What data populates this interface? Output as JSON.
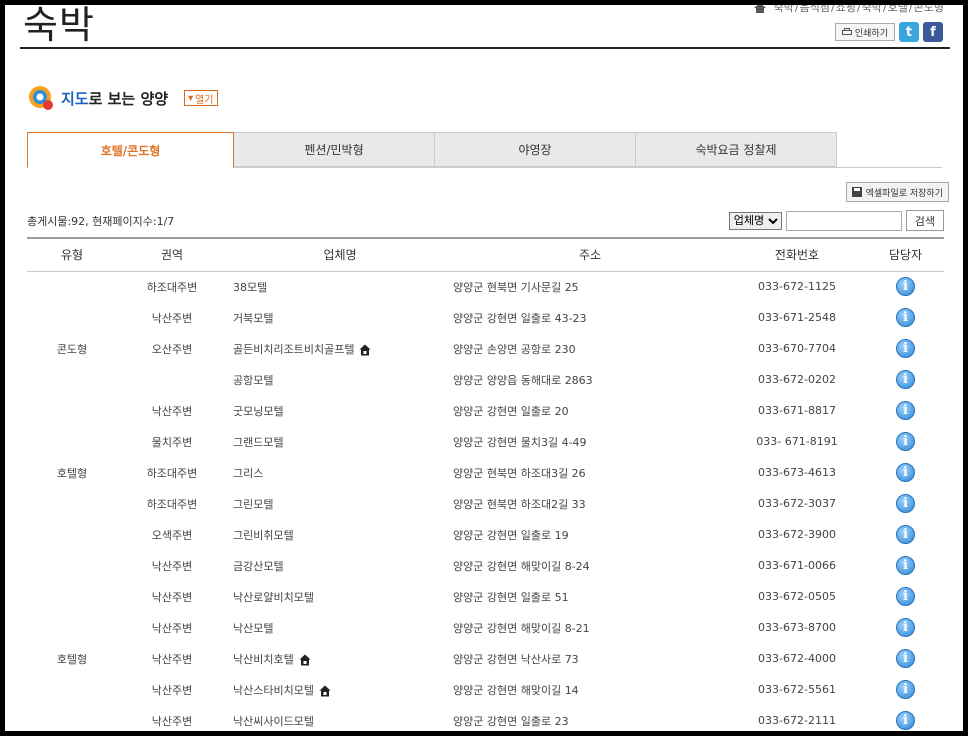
{
  "header": {
    "title": "숙박",
    "breadcrumb": [
      "숙박",
      "음식점",
      "쇼핑",
      "숙박",
      "호텔",
      "콘도형"
    ],
    "print_label": "인쇄하기"
  },
  "map": {
    "title_highlight": "지도",
    "title_rest": "로 보는 양양",
    "open_label": "열기"
  },
  "tabs": [
    {
      "label": "호텔/콘도형",
      "active": true
    },
    {
      "label": "펜션/민박형",
      "active": false
    },
    {
      "label": "야영장",
      "active": false
    },
    {
      "label": "숙박요금 정찰제",
      "active": false
    }
  ],
  "excel_label": "엑셀파일로 저장하기",
  "summary": "총게시물:92, 현재페이지수:1/7",
  "search": {
    "select_value": "업체명",
    "input_value": "",
    "button_label": "검색"
  },
  "table": {
    "headers": [
      "유형",
      "권역",
      "업체명",
      "주소",
      "전화번호",
      "담당자"
    ],
    "rows": [
      {
        "type": "",
        "area": "하조대주변",
        "name": "38모텔",
        "addr": "양양군 현북면 기사문길 25",
        "phone": "033-672-1125",
        "house": false
      },
      {
        "type": "",
        "area": "낙산주변",
        "name": "거북모텔",
        "addr": "양양군 강현면 일출로 43-23",
        "phone": "033-671-2548",
        "house": false
      },
      {
        "type": "콘도형",
        "area": "오산주변",
        "name": "골든비치리조트비치골프텔",
        "addr": "양양군 손양면 공항로 230",
        "phone": "033-670-7704",
        "house": true
      },
      {
        "type": "",
        "area": "",
        "name": "공항모텔",
        "addr": "양양군 양양읍 동해대로 2863",
        "phone": "033-672-0202",
        "house": false
      },
      {
        "type": "",
        "area": "낙산주변",
        "name": "굿모닝모텔",
        "addr": "양양군 강현면 일출로 20",
        "phone": "033-671-8817",
        "house": false
      },
      {
        "type": "",
        "area": "물치주변",
        "name": "그랜드모텔",
        "addr": "양양군 강현면 물치3길 4-49",
        "phone": "033- 671-8191",
        "house": false
      },
      {
        "type": "호텔형",
        "area": "하조대주변",
        "name": "그리스",
        "addr": "양양군 현북면 하조대3길 26",
        "phone": "033-673-4613",
        "house": false
      },
      {
        "type": "",
        "area": "하조대주변",
        "name": "그린모텔",
        "addr": "양양군 현북면 하조대2길 33",
        "phone": "033-672-3037",
        "house": false
      },
      {
        "type": "",
        "area": "오색주변",
        "name": "그린비취모텔",
        "addr": "양양군 강현면 일출로 19",
        "phone": "033-672-3900",
        "house": false
      },
      {
        "type": "",
        "area": "낙산주변",
        "name": "금강산모텔",
        "addr": "양양군 강현면 해맞이길 8-24",
        "phone": "033-671-0066",
        "house": false
      },
      {
        "type": "",
        "area": "낙산주변",
        "name": "낙산로얄비치모텔",
        "addr": "양양군 강현면 일출로 51",
        "phone": "033-672-0505",
        "house": false
      },
      {
        "type": "",
        "area": "낙산주변",
        "name": "낙산모텔",
        "addr": "양양군 강현면 해맞이길 8-21",
        "phone": "033-673-8700",
        "house": false
      },
      {
        "type": "호텔형",
        "area": "낙산주변",
        "name": "낙산비치호텔",
        "addr": "양양군 강현면 낙산사로 73",
        "phone": "033-672-4000",
        "house": true
      },
      {
        "type": "",
        "area": "낙산주변",
        "name": "낙산스타비치모텔",
        "addr": "양양군 강현면 해맞이길 14",
        "phone": "033-672-5561",
        "house": true
      },
      {
        "type": "",
        "area": "낙산주변",
        "name": "낙산씨사이드모텔",
        "addr": "양양군 강현면 일출로 23",
        "phone": "033-672-2111",
        "house": false
      }
    ]
  },
  "icons": {
    "home": "home-icon",
    "info": "info-icon",
    "house": "house-icon",
    "twitter": "twitter-icon",
    "facebook": "facebook-icon"
  },
  "colors": {
    "accent": "#e0762a",
    "info_blue": "#2b84d4",
    "map_blue": "#1c64c0"
  }
}
